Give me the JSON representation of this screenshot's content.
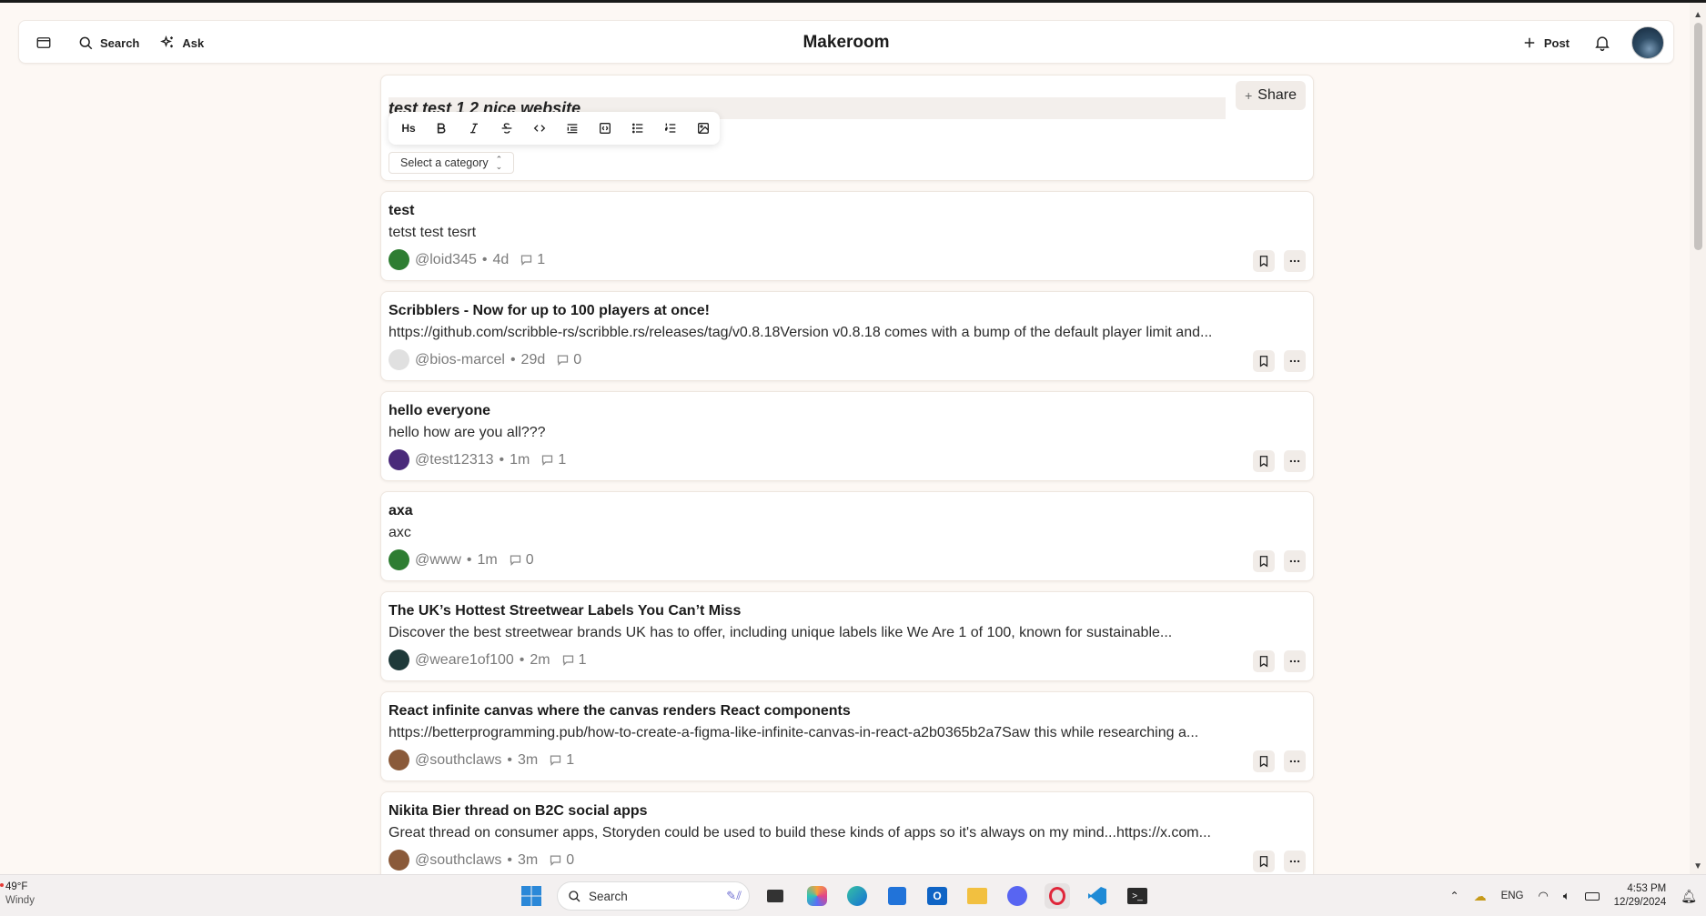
{
  "app": {
    "title": "Makeroom",
    "search_label": "Search",
    "ask_label": "Ask",
    "post_label": "Post"
  },
  "composer": {
    "title_value": "test test 1 2  nice website",
    "share_label": "Share",
    "category_label": "Select a category",
    "toolbar": [
      "Hs",
      "bold",
      "italic",
      "strikethrough",
      "code",
      "blockquote",
      "code-block",
      "bullet-list",
      "ordered-list",
      "image"
    ]
  },
  "posts": [
    {
      "title": "test",
      "body": "tetst test tesrt",
      "author": "@loid345",
      "age": "4d",
      "comments": "1",
      "avatar_color": "#2e7d32"
    },
    {
      "title": "Scribblers - Now for up to 100 players at once!",
      "body": "https://github.com/scribble-rs/scribble.rs/releases/tag/v0.8.18Version v0.8.18 comes with a bump of the default player limit and...",
      "author": "@bios-marcel",
      "age": "29d",
      "comments": "0",
      "avatar_color": "#e0e0e0"
    },
    {
      "title": "hello everyone",
      "body": "hello how are you all???",
      "author": "@test12313",
      "age": "1m",
      "comments": "1",
      "avatar_color": "#4a2a7a"
    },
    {
      "title": "axa",
      "body": "axc",
      "author": "@www",
      "age": "1m",
      "comments": "0",
      "avatar_color": "#2e7d32"
    },
    {
      "title": "The UK’s Hottest Streetwear Labels You Can’t Miss",
      "body": "Discover the best streetwear brands UK has to offer, including unique labels like We Are 1 of 100, known for sustainable...",
      "author": "@weare1of100",
      "age": "2m",
      "comments": "1",
      "avatar_color": "#1f3a3a"
    },
    {
      "title": "React infinite canvas where the canvas renders React components",
      "body": "https://betterprogramming.pub/how-to-create-a-figma-like-infinite-canvas-in-react-a2b0365b2a7Saw this while researching a...",
      "author": "@southclaws",
      "age": "3m",
      "comments": "1",
      "avatar_color": "#8a5a3a"
    },
    {
      "title": "Nikita Bier thread on B2C social apps",
      "body": "Great thread on consumer apps, Storyden could be used to build these kinds of apps so it's always on my mind...https://x.com...",
      "author": "@southclaws",
      "age": "3m",
      "comments": "0",
      "avatar_color": "#8a5a3a"
    }
  ],
  "taskbar": {
    "temp": "49°F",
    "weather": "Windy",
    "search_placeholder": "Search",
    "lang": "ENG",
    "time": "4:53 PM",
    "date": "12/29/2024"
  }
}
